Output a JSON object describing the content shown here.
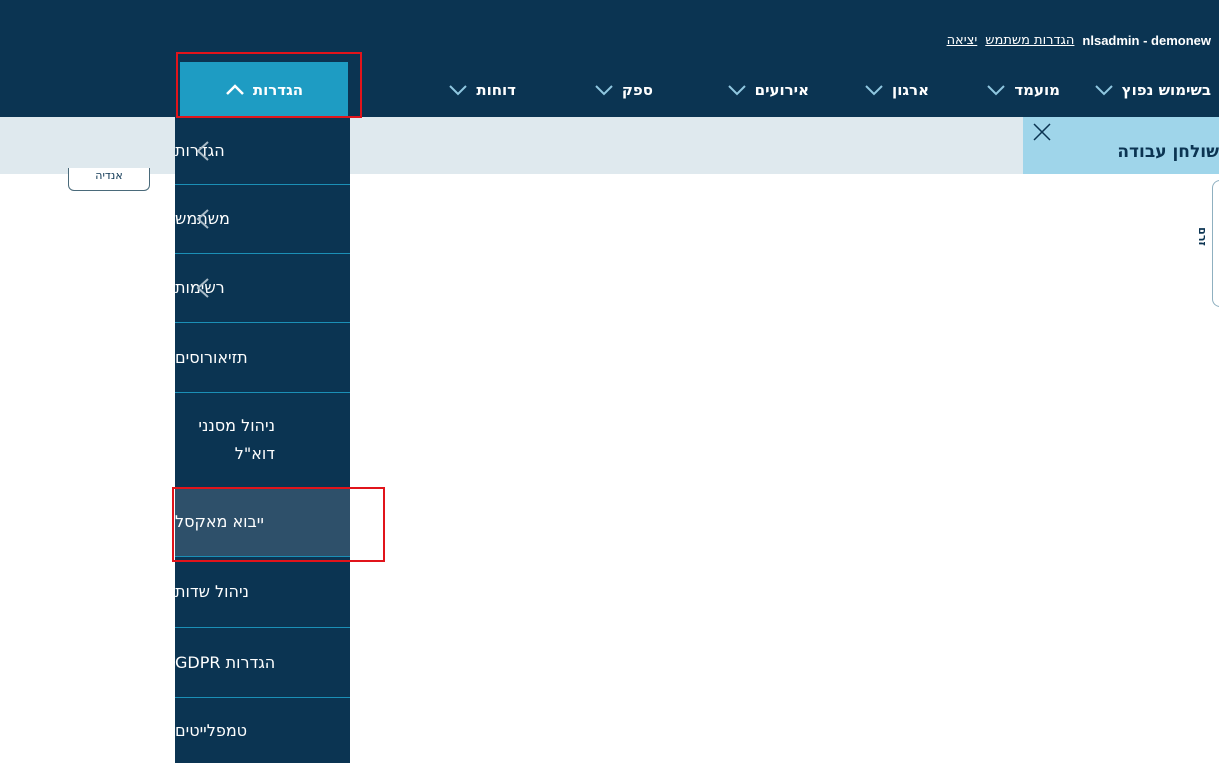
{
  "header": {
    "user_name": "nlsadmin - demonew",
    "links": [
      "הגדרות משתמש",
      "יציאה"
    ]
  },
  "nav": {
    "items": [
      "בשימוש נפוץ",
      "מועמד",
      "ארגון",
      "אירועים",
      "ספק",
      "דוחות",
      "הגדרות"
    ],
    "active": "הגדרות"
  },
  "workspace": {
    "tab_title": "שולחן עבודה",
    "left_tag": "אנדיה",
    "side_tab": "זרם"
  },
  "dropdown": {
    "items": [
      {
        "label": "הגדרות",
        "submenu": true
      },
      {
        "label": "משתמש",
        "submenu": true
      },
      {
        "label": "רשימות",
        "submenu": true
      },
      {
        "label": "תזיאורוסים",
        "submenu": false
      },
      {
        "label": "ניהול מסנני דוא\"ל",
        "submenu": false
      },
      {
        "label": "ייבוא מאקסל",
        "submenu": false,
        "hovered": true
      },
      {
        "label": "ניהול שדות",
        "submenu": false
      },
      {
        "label": "הגדרות GDPR",
        "submenu": false
      },
      {
        "label": "טמפלייטים",
        "submenu": false
      }
    ]
  },
  "colors": {
    "header_bg": "#0b3452",
    "active_tab": "#1e9cc3",
    "highlight": "#e1141b"
  }
}
